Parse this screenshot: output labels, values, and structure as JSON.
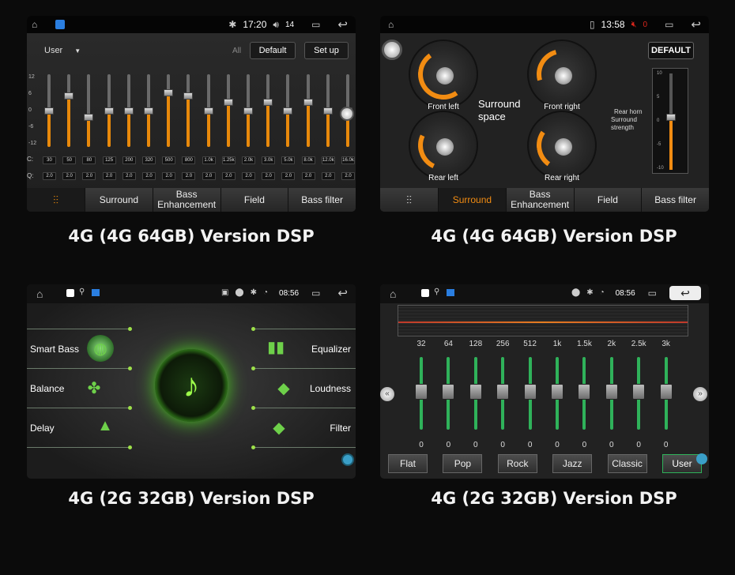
{
  "captions": [
    "4G (4G 64GB) Version DSP",
    "4G (4G 64GB) Version DSP",
    "4G (2G 32GB) Version DSP",
    "4G (2G 32GB) Version DSP"
  ],
  "panel1": {
    "status": {
      "time": "17:20",
      "volume": "14"
    },
    "preset": "User",
    "all_label": "All",
    "default_label": "Default",
    "setup_label": "Set up",
    "scale": [
      "12",
      "6",
      "0",
      "-6",
      "-12"
    ],
    "fc_label": "C:",
    "q_label": "Q:",
    "freqs": [
      "30",
      "50",
      "80",
      "125",
      "200",
      "320",
      "500",
      "800",
      "1.0k",
      "1.25k",
      "2.0k",
      "3.0k",
      "5.0k",
      "8.0k",
      "12.0k",
      "16.0k"
    ],
    "q_values": [
      "2.0",
      "2.0",
      "2.0",
      "2.0",
      "2.0",
      "2.0",
      "2.0",
      "2.0",
      "2.0",
      "2.0",
      "2.0",
      "2.0",
      "2.0",
      "2.0",
      "2.0",
      "2.0"
    ],
    "gains": [
      0,
      5,
      -2,
      0,
      0,
      0,
      6,
      5,
      0,
      3,
      0,
      3,
      0,
      3,
      0,
      0
    ],
    "tabs": [
      "Surround",
      "Bass Enhancement",
      "Field",
      "Bass filter"
    ]
  },
  "panel2": {
    "status": {
      "time": "13:58",
      "volume": "0"
    },
    "default_label": "DEFAULT",
    "dials": [
      "Front left",
      "Front right",
      "Rear left",
      "Rear right"
    ],
    "center_label": "Surround space",
    "rear_horn": "Rear horn",
    "surround_strength": "Surround strength",
    "scale": [
      "10",
      "5",
      "0",
      "-5",
      "-10"
    ],
    "strength_level": 0.55,
    "tabs": [
      "Surround",
      "Bass Enhancement",
      "Field",
      "Bass filter"
    ],
    "active_tab": "Surround"
  },
  "panel3": {
    "status": {
      "time": "08:56"
    },
    "features_left": [
      "Smart Bass",
      "Balance",
      "Delay"
    ],
    "features_right": [
      "Equalizer",
      "Loudness",
      "Filter"
    ]
  },
  "panel4": {
    "status": {
      "time": "08:56"
    },
    "freqs": [
      "32",
      "64",
      "128",
      "256",
      "512",
      "1k",
      "1.5k",
      "2k",
      "2.5k",
      "3k"
    ],
    "values": [
      "0",
      "0",
      "0",
      "0",
      "0",
      "0",
      "0",
      "0",
      "0",
      "0"
    ],
    "presets": [
      "Flat",
      "Pop",
      "Rock",
      "Jazz",
      "Classic",
      "User"
    ],
    "active_preset": "User"
  }
}
